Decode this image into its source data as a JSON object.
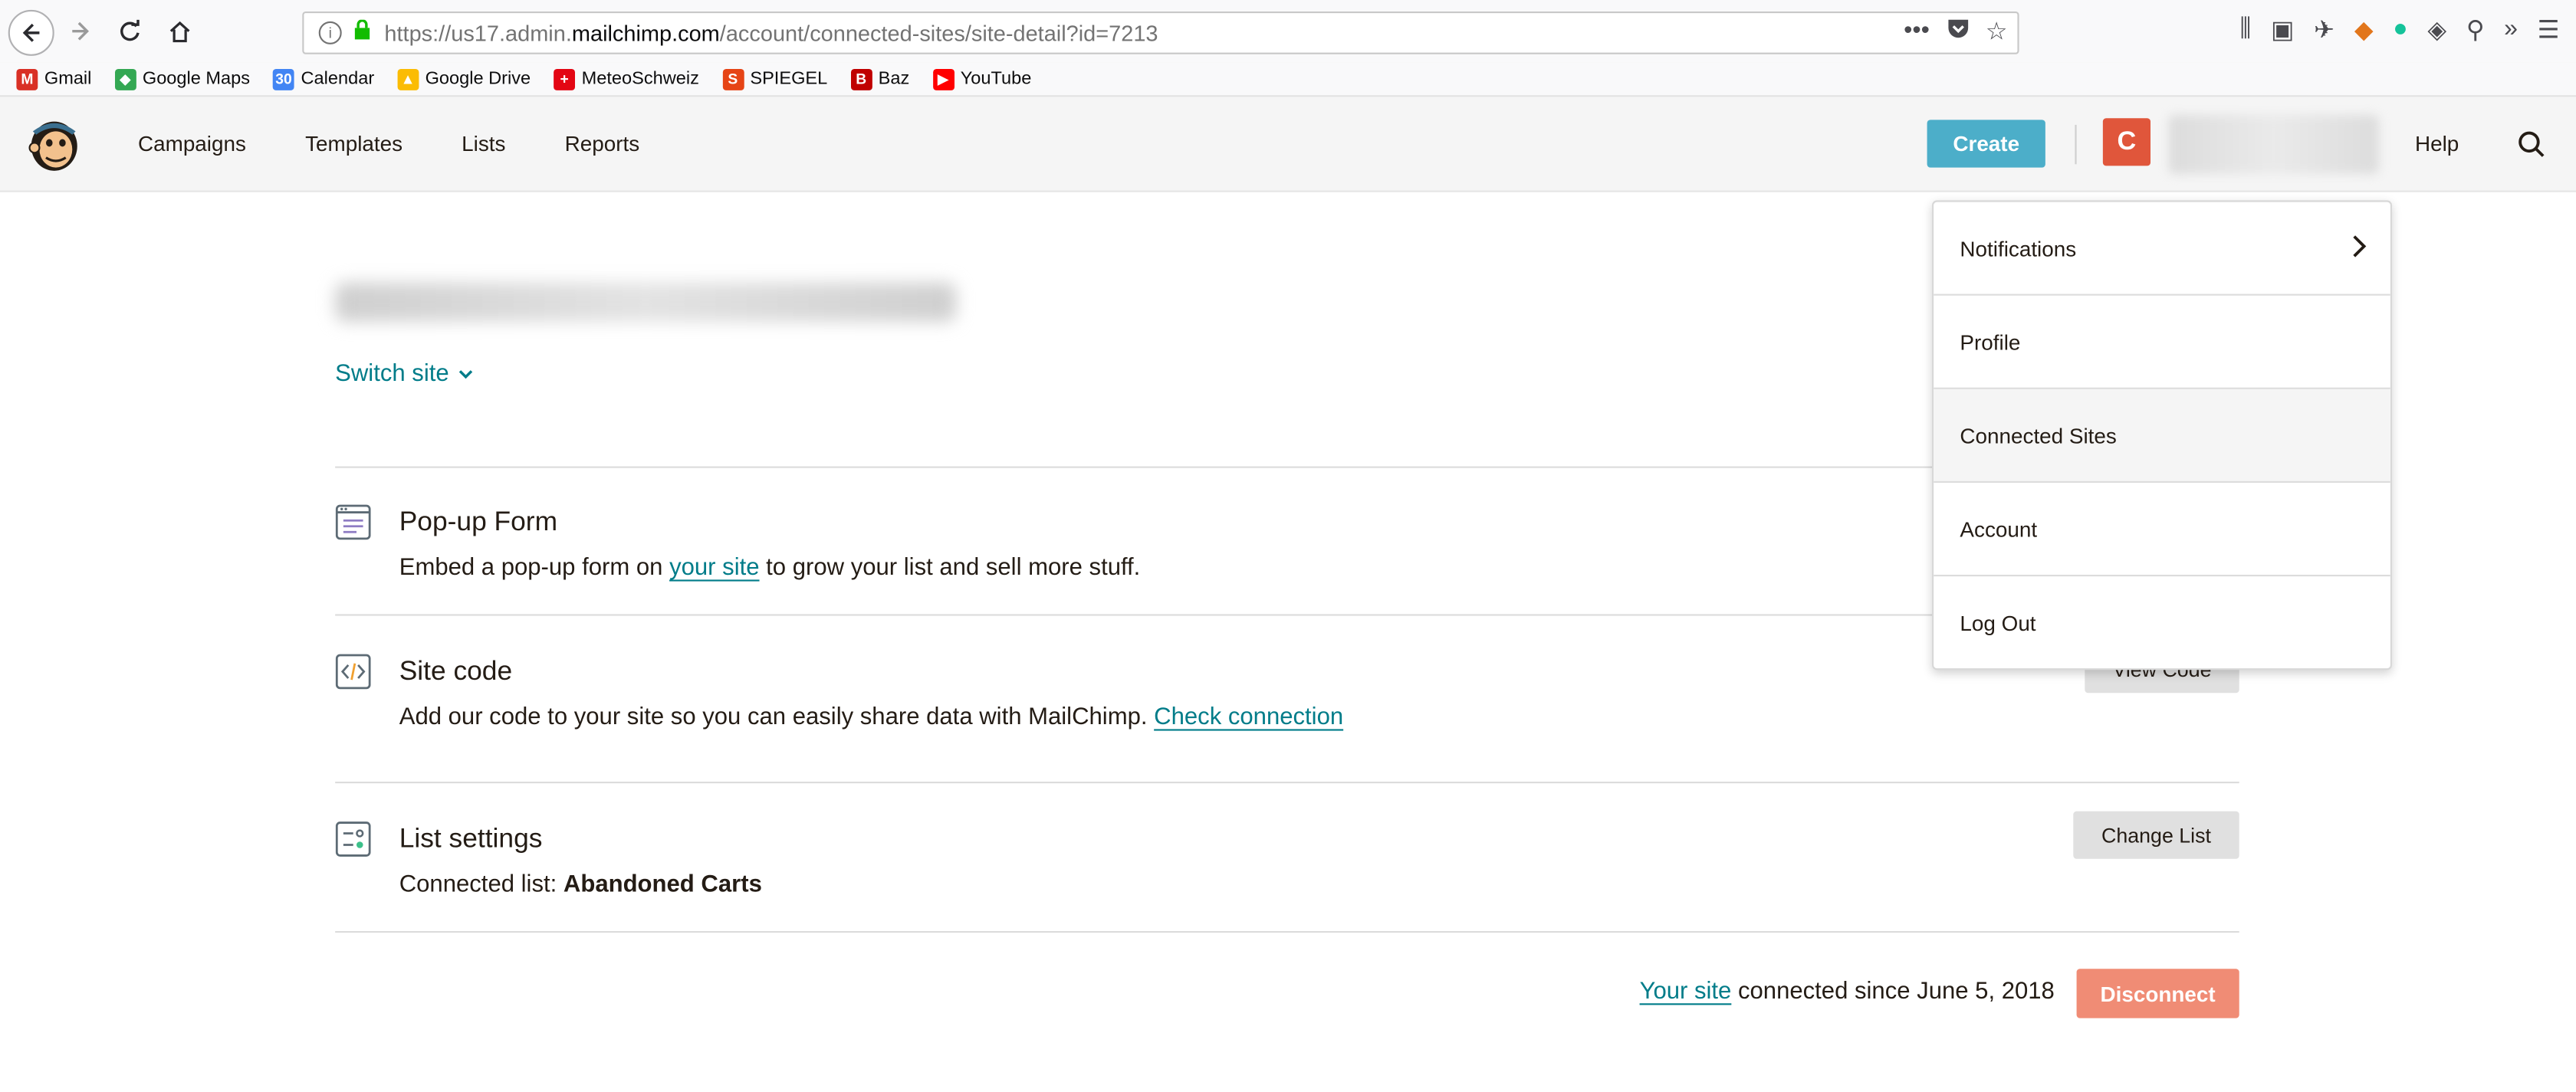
{
  "browser": {
    "url_prefix": "https://us17.admin.",
    "url_host": "mailchimp.com",
    "url_path": "/account/connected-sites/site-detail?id=7213",
    "bookmarks": [
      {
        "label": "Gmail",
        "icon": "gmail-icon",
        "color": "#d93025",
        "glyph": "M"
      },
      {
        "label": "Google Maps",
        "icon": "maps-icon",
        "color": "#34a853",
        "glyph": "◆"
      },
      {
        "label": "Calendar",
        "icon": "calendar-icon",
        "color": "#4285f4",
        "glyph": "30"
      },
      {
        "label": "Google Drive",
        "icon": "drive-icon",
        "color": "#fbbc04",
        "glyph": "▲"
      },
      {
        "label": "MeteoSchweiz",
        "icon": "swiss-flag-icon",
        "color": "#e30613",
        "glyph": "+"
      },
      {
        "label": "SPIEGEL",
        "icon": "spiegel-icon",
        "color": "#e64415",
        "glyph": "S"
      },
      {
        "label": "Baz",
        "icon": "baz-icon",
        "color": "#c00000",
        "glyph": "B"
      },
      {
        "label": "YouTube",
        "icon": "youtube-icon",
        "color": "#ff0000",
        "glyph": "▶"
      }
    ]
  },
  "header": {
    "nav": [
      "Campaigns",
      "Templates",
      "Lists",
      "Reports"
    ],
    "create_label": "Create",
    "avatar_initial": "C",
    "help_label": "Help"
  },
  "main": {
    "switch_site_label": "Switch site",
    "popup_form": {
      "title": "Pop-up Form",
      "desc_before": "Embed a pop-up form on ",
      "desc_link": "your site",
      "desc_after": " to grow your list and sell more stuff."
    },
    "site_code": {
      "title": "Site code",
      "desc_before": "Add our code to your site so you can easily share data with MailChimp. ",
      "desc_link": "Check connection",
      "button": "View Code"
    },
    "list_settings": {
      "title": "List settings",
      "desc_before": "Connected list: ",
      "desc_bold": "Abandoned Carts",
      "button": "Change List"
    },
    "footer": {
      "link": "Your site",
      "text": " connected since June 5, 2018",
      "disconnect_label": "Disconnect"
    }
  },
  "dropdown": {
    "items": [
      "Notifications",
      "Profile",
      "Connected Sites",
      "Account",
      "Log Out"
    ],
    "active": "Connected Sites"
  },
  "colors": {
    "accent_link": "#007c89",
    "create_button": "#4caec9",
    "disconnect_button": "#f08c75",
    "avatar": "#e0563b"
  }
}
